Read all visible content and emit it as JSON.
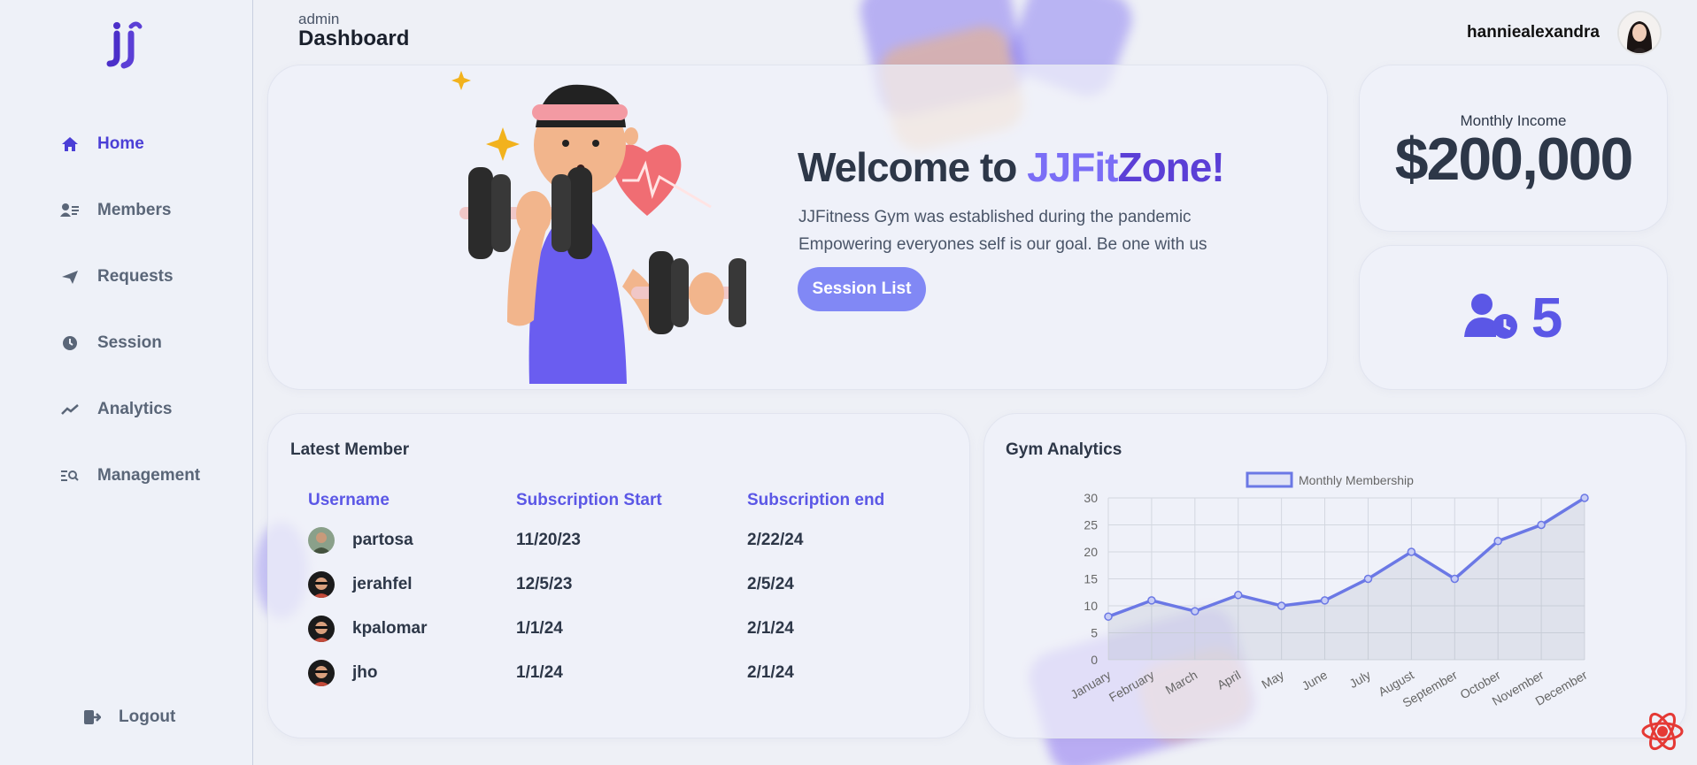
{
  "sidebar": {
    "logo_icon": "jj-logo-icon",
    "items": [
      {
        "label": "Home",
        "icon": "home-icon",
        "active": true
      },
      {
        "label": "Members",
        "icon": "members-icon"
      },
      {
        "label": "Requests",
        "icon": "paper-plane-icon"
      },
      {
        "label": "Session",
        "icon": "clock-icon"
      },
      {
        "label": "Analytics",
        "icon": "trend-icon"
      },
      {
        "label": "Management",
        "icon": "search-list-icon"
      }
    ],
    "logout_label": "Logout"
  },
  "header": {
    "role": "admin",
    "title": "Dashboard",
    "username": "hanniealexandra"
  },
  "welcome": {
    "title_prefix": "Welcome to ",
    "brand_a": "JJFit",
    "brand_b": "Zone!",
    "line1": "JJFitness Gym was established during the pandemic",
    "line2": "Empowering everyones self is our goal. Be one with us",
    "button": "Session List"
  },
  "income": {
    "label": "Monthly Income",
    "value": "$200,000"
  },
  "sessions": {
    "icon": "user-clock-icon",
    "count": "5"
  },
  "members": {
    "title": "Latest Member",
    "columns": [
      "Username",
      "Subscription Start",
      "Subscription end"
    ],
    "rows": [
      {
        "username": "partosa",
        "start": "11/20/23",
        "end": "2/22/24"
      },
      {
        "username": "jerahfel",
        "start": "12/5/23",
        "end": "2/5/24"
      },
      {
        "username": "kpalomar",
        "start": "1/1/24",
        "end": "2/1/24"
      },
      {
        "username": "jho",
        "start": "1/1/24",
        "end": "2/1/24"
      }
    ]
  },
  "analytics": {
    "title": "Gym Analytics"
  },
  "colors": {
    "accent": "#5b57e6",
    "button": "#8188f5",
    "line": "#6b78e5"
  },
  "chart_data": {
    "type": "line",
    "title": "Gym Analytics",
    "categories": [
      "January",
      "February",
      "March",
      "April",
      "May",
      "June",
      "July",
      "August",
      "September",
      "October",
      "November",
      "December"
    ],
    "series": [
      {
        "name": "Monthly Membership",
        "values": [
          8,
          11,
          9,
          12,
          10,
          11,
          15,
          20,
          15,
          22,
          25,
          30
        ]
      }
    ],
    "ylim": [
      0,
      30
    ],
    "yticks": [
      "0",
      "5",
      "10",
      "15",
      "20",
      "25",
      "30"
    ],
    "grid": true,
    "legend": "top-center"
  }
}
